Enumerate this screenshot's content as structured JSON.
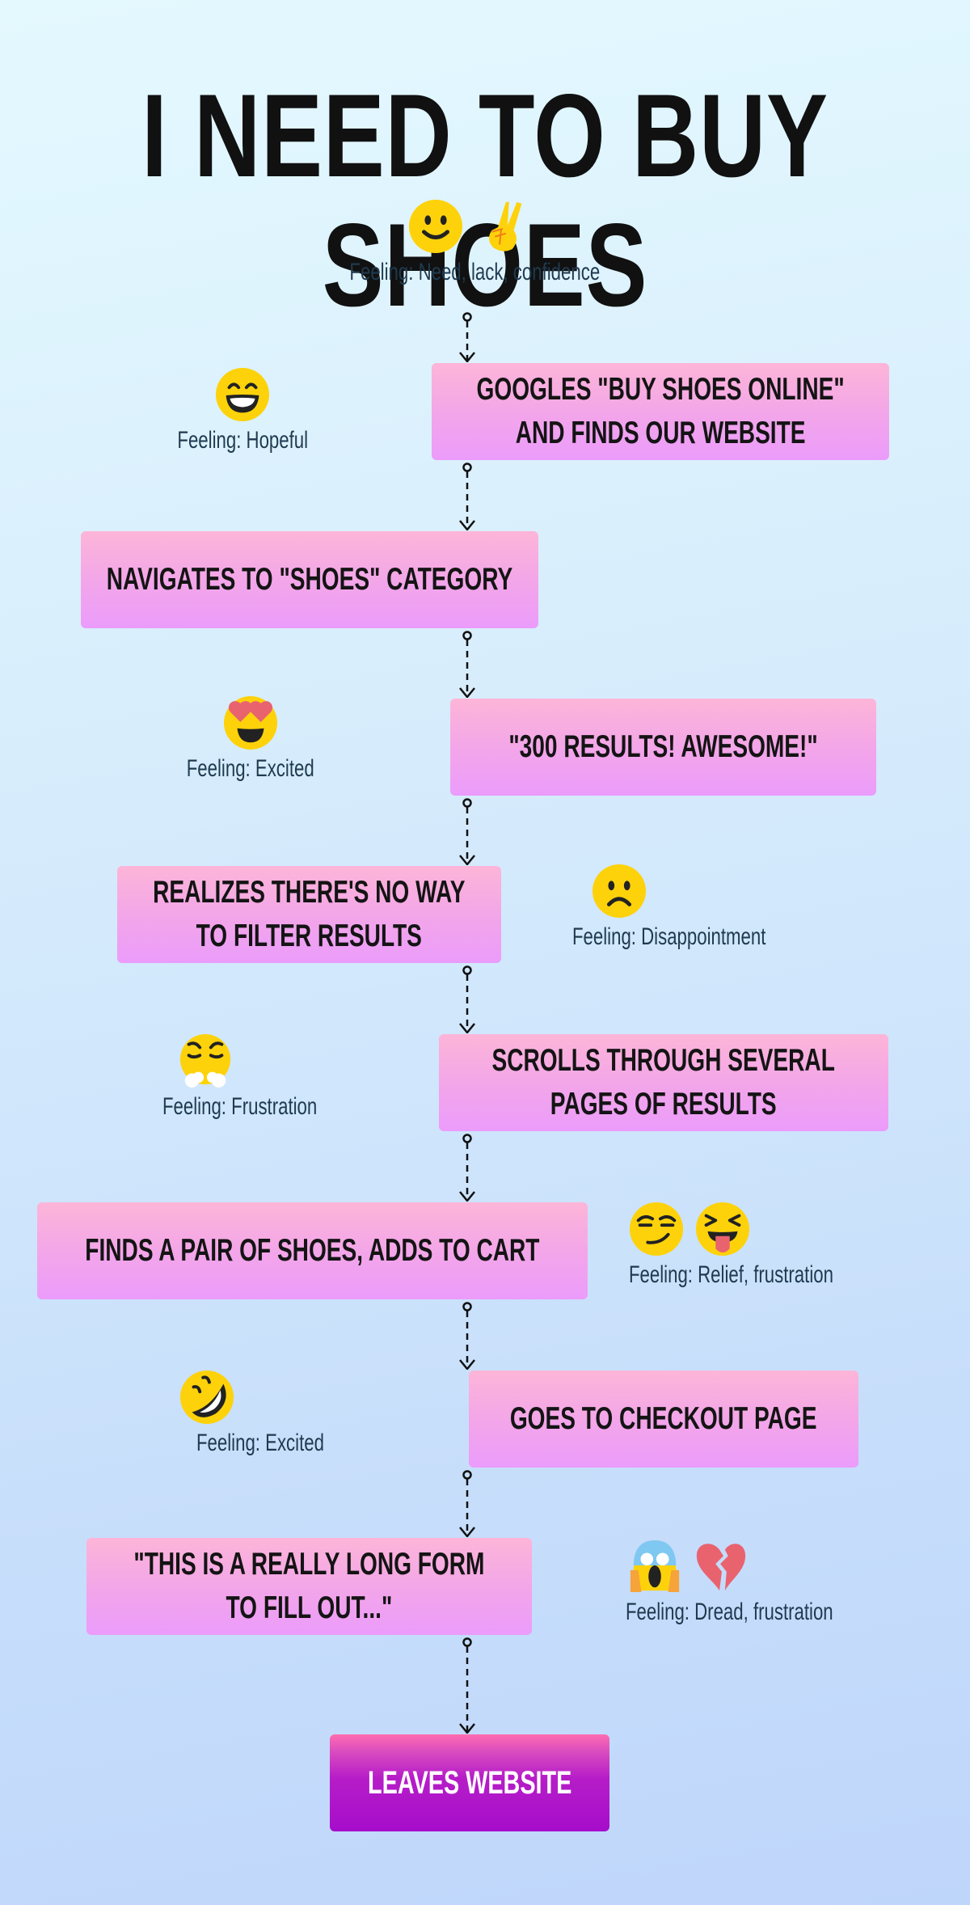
{
  "title": "I NEED TO BUY SHOES",
  "start_feeling": {
    "emojis": [
      "slightly-smiling-face",
      "victory-hand"
    ],
    "label": "Feeling: Need, lack, confidence"
  },
  "steps": [
    {
      "lines": [
        "GOOGLES \"BUY SHOES ONLINE\"",
        "AND FINDS OUR WEBSITE"
      ],
      "feeling": {
        "emojis": [
          "grinning-face-smiling-eyes"
        ],
        "label": "Feeling: Hopeful"
      }
    },
    {
      "lines": [
        "NAVIGATES TO \"SHOES\" CATEGORY"
      ],
      "feeling": null
    },
    {
      "lines": [
        "\"300 RESULTS! AWESOME!\""
      ],
      "feeling": {
        "emojis": [
          "heart-eyes-face"
        ],
        "label": "Feeling: Excited"
      }
    },
    {
      "lines": [
        "REALIZES THERE'S NO WAY",
        "TO FILTER RESULTS"
      ],
      "feeling": {
        "emojis": [
          "frowning-face"
        ],
        "label": "Feeling: Disappointment"
      }
    },
    {
      "lines": [
        "SCROLLS THROUGH SEVERAL",
        "PAGES OF RESULTS"
      ],
      "feeling": {
        "emojis": [
          "face-with-steam-from-nose"
        ],
        "label": "Feeling: Frustration"
      }
    },
    {
      "lines": [
        "FINDS A PAIR OF SHOES, ADDS TO CART"
      ],
      "feeling": {
        "emojis": [
          "smirking-face",
          "squinting-face-with-tongue"
        ],
        "label": "Feeling: Relief, frustration"
      }
    },
    {
      "lines": [
        "GOES TO CHECKOUT PAGE"
      ],
      "feeling": {
        "emojis": [
          "rolling-on-floor-laughing"
        ],
        "label": "Feeling: Excited"
      }
    },
    {
      "lines": [
        "\"THIS IS A REALLY LONG FORM",
        "TO FILL OUT...\""
      ],
      "feeling": {
        "emojis": [
          "face-screaming-in-fear",
          "broken-heart"
        ],
        "label": "Feeling: Dread, frustration"
      }
    },
    {
      "lines": [
        "LEAVES WEBSITE"
      ],
      "feeling": null
    }
  ],
  "colors": {
    "step_gradient": [
      "#fdb5d8",
      "#eb9cfb"
    ],
    "final_gradient": [
      "#ff6cb0",
      "#a60dcb"
    ],
    "emoji_yellow": "#fdd20a",
    "heart_red": "#e9636f"
  }
}
